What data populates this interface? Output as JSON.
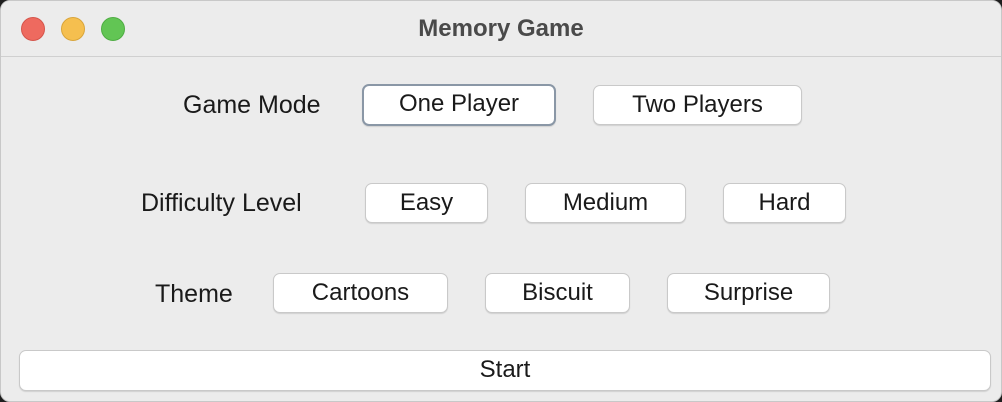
{
  "window": {
    "title": "Memory Game"
  },
  "game_mode": {
    "label": "Game Mode",
    "options": [
      "One Player",
      "Two Players"
    ],
    "focused": "One Player"
  },
  "difficulty": {
    "label": "Difficulty Level",
    "options": [
      "Easy",
      "Medium",
      "Hard"
    ]
  },
  "theme": {
    "label": "Theme",
    "options": [
      "Cartoons",
      "Biscuit",
      "Surprise"
    ]
  },
  "start": {
    "label": "Start"
  },
  "colors": {
    "close": "#ee6a5f",
    "minimize": "#f5bf4f",
    "maximize": "#62c554",
    "background": "#ececec"
  }
}
